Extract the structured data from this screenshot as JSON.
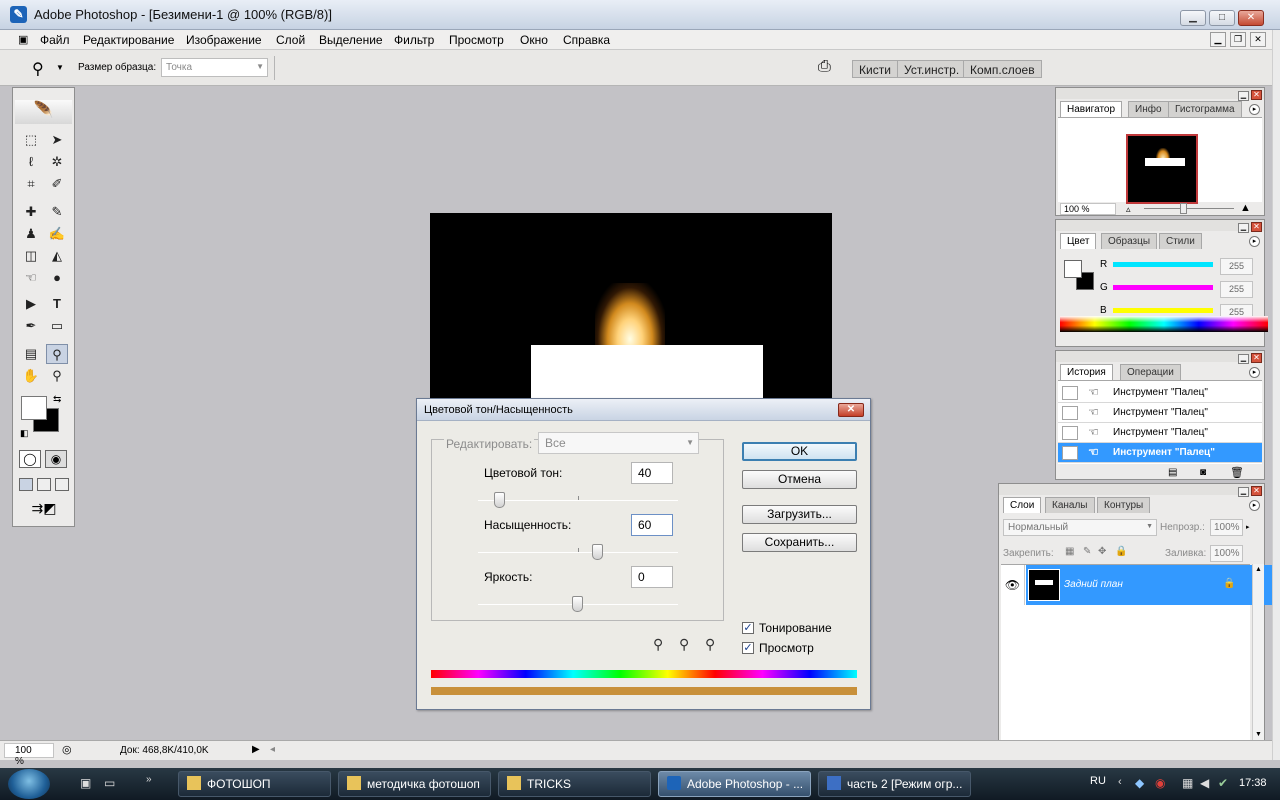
{
  "window": {
    "title": "Adobe Photoshop - [Безимени-1 @ 100% (RGB/8)]"
  },
  "menu": [
    "Файл",
    "Редактирование",
    "Изображение",
    "Слой",
    "Выделение",
    "Фильтр",
    "Просмотр",
    "Окно",
    "Справка"
  ],
  "options": {
    "sample_label": "Размер образца:",
    "sample_value": "Точка",
    "palette_tabs": [
      "Кисти",
      "Уст.инстр.",
      "Комп.слоев"
    ]
  },
  "dialog": {
    "title": "Цветовой тон/Насыщенность",
    "edit_label": "Редактировать:",
    "edit_value": "Все",
    "hue": {
      "label": "Цветовой тон:",
      "value": "40"
    },
    "saturation": {
      "label": "Насыщенность:",
      "value": "60"
    },
    "lightness": {
      "label": "Яркость:",
      "value": "0"
    },
    "buttons": {
      "ok": "OK",
      "cancel": "Отмена",
      "load": "Загрузить...",
      "save": "Сохранить..."
    },
    "colorize": {
      "label": "Тонирование",
      "checked": true
    },
    "preview": {
      "label": "Просмотр",
      "checked": true
    }
  },
  "navigator": {
    "tabs": [
      "Навигатор",
      "Инфо",
      "Гистограмма"
    ],
    "zoom": "100 %"
  },
  "color": {
    "tabs": [
      "Цвет",
      "Образцы",
      "Стили"
    ],
    "channels": [
      {
        "name": "R",
        "value": "255",
        "color": "#00e5ff"
      },
      {
        "name": "G",
        "value": "255",
        "color": "#ff00ff"
      },
      {
        "name": "B",
        "value": "255",
        "color": "#ffff00"
      }
    ]
  },
  "history": {
    "tabs": [
      "История",
      "Операции"
    ],
    "items": [
      "Инструмент \"Палец\"",
      "Инструмент \"Палец\"",
      "Инструмент \"Палец\"",
      "Инструмент \"Палец\""
    ]
  },
  "layers": {
    "tabs": [
      "Слои",
      "Каналы",
      "Контуры"
    ],
    "blend_mode": "Нормальный",
    "opacity_label": "Непрозр.:",
    "opacity": "100%",
    "lock_label": "Закрепить:",
    "fill_label": "Заливка:",
    "fill": "100%",
    "layer_name": "Задний план"
  },
  "status": {
    "zoom": "100 %",
    "doc": "Док: 468,8K/410,0K"
  },
  "taskbar": {
    "items": [
      "ФОТОШОП",
      "методичка фотошоп",
      "TRICKS",
      "Adobe Photoshop - ...",
      "часть 2 [Режим огр..."
    ],
    "lang": "RU",
    "time": "17:38"
  },
  "colors": {
    "selection": "#3399ff",
    "dialog_bg": "#ecebe6",
    "canvas": "#000000"
  }
}
